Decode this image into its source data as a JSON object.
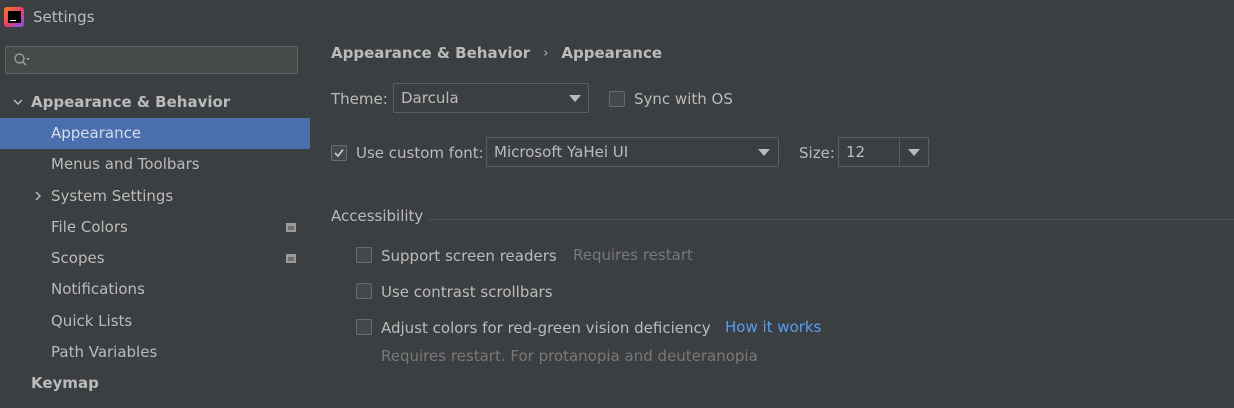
{
  "window": {
    "title": "Settings"
  },
  "search": {
    "placeholder": ""
  },
  "sidebar": {
    "items": [
      {
        "label": "Appearance & Behavior"
      },
      {
        "label": "Appearance"
      },
      {
        "label": "Menus and Toolbars"
      },
      {
        "label": "System Settings"
      },
      {
        "label": "File Colors"
      },
      {
        "label": "Scopes"
      },
      {
        "label": "Notifications"
      },
      {
        "label": "Quick Lists"
      },
      {
        "label": "Path Variables"
      },
      {
        "label": "Keymap"
      }
    ]
  },
  "breadcrumb": {
    "parent": "Appearance & Behavior",
    "separator": "›",
    "current": "Appearance"
  },
  "theme": {
    "label": "Theme:",
    "value": "Darcula",
    "sync_label": "Sync with OS",
    "sync_checked": false
  },
  "font": {
    "use_custom_label": "Use custom font:",
    "use_custom_checked": true,
    "family_value": "Microsoft YaHei UI",
    "size_label": "Size:",
    "size_value": "12"
  },
  "accessibility": {
    "title": "Accessibility",
    "screen_readers_label": "Support screen readers",
    "screen_readers_note": "Requires restart",
    "contrast_scrollbars_label": "Use contrast scrollbars",
    "color_adjust_label": "Adjust colors for red-green vision deficiency",
    "how_it_works_link": "How it works",
    "color_adjust_note": "Requires restart. For protanopia and deuteranopia"
  },
  "colors": {
    "background": "#3c3f41",
    "selection": "#4b6eaf",
    "link": "#589df6",
    "text": "#bbbbbb",
    "muted": "#787878"
  }
}
